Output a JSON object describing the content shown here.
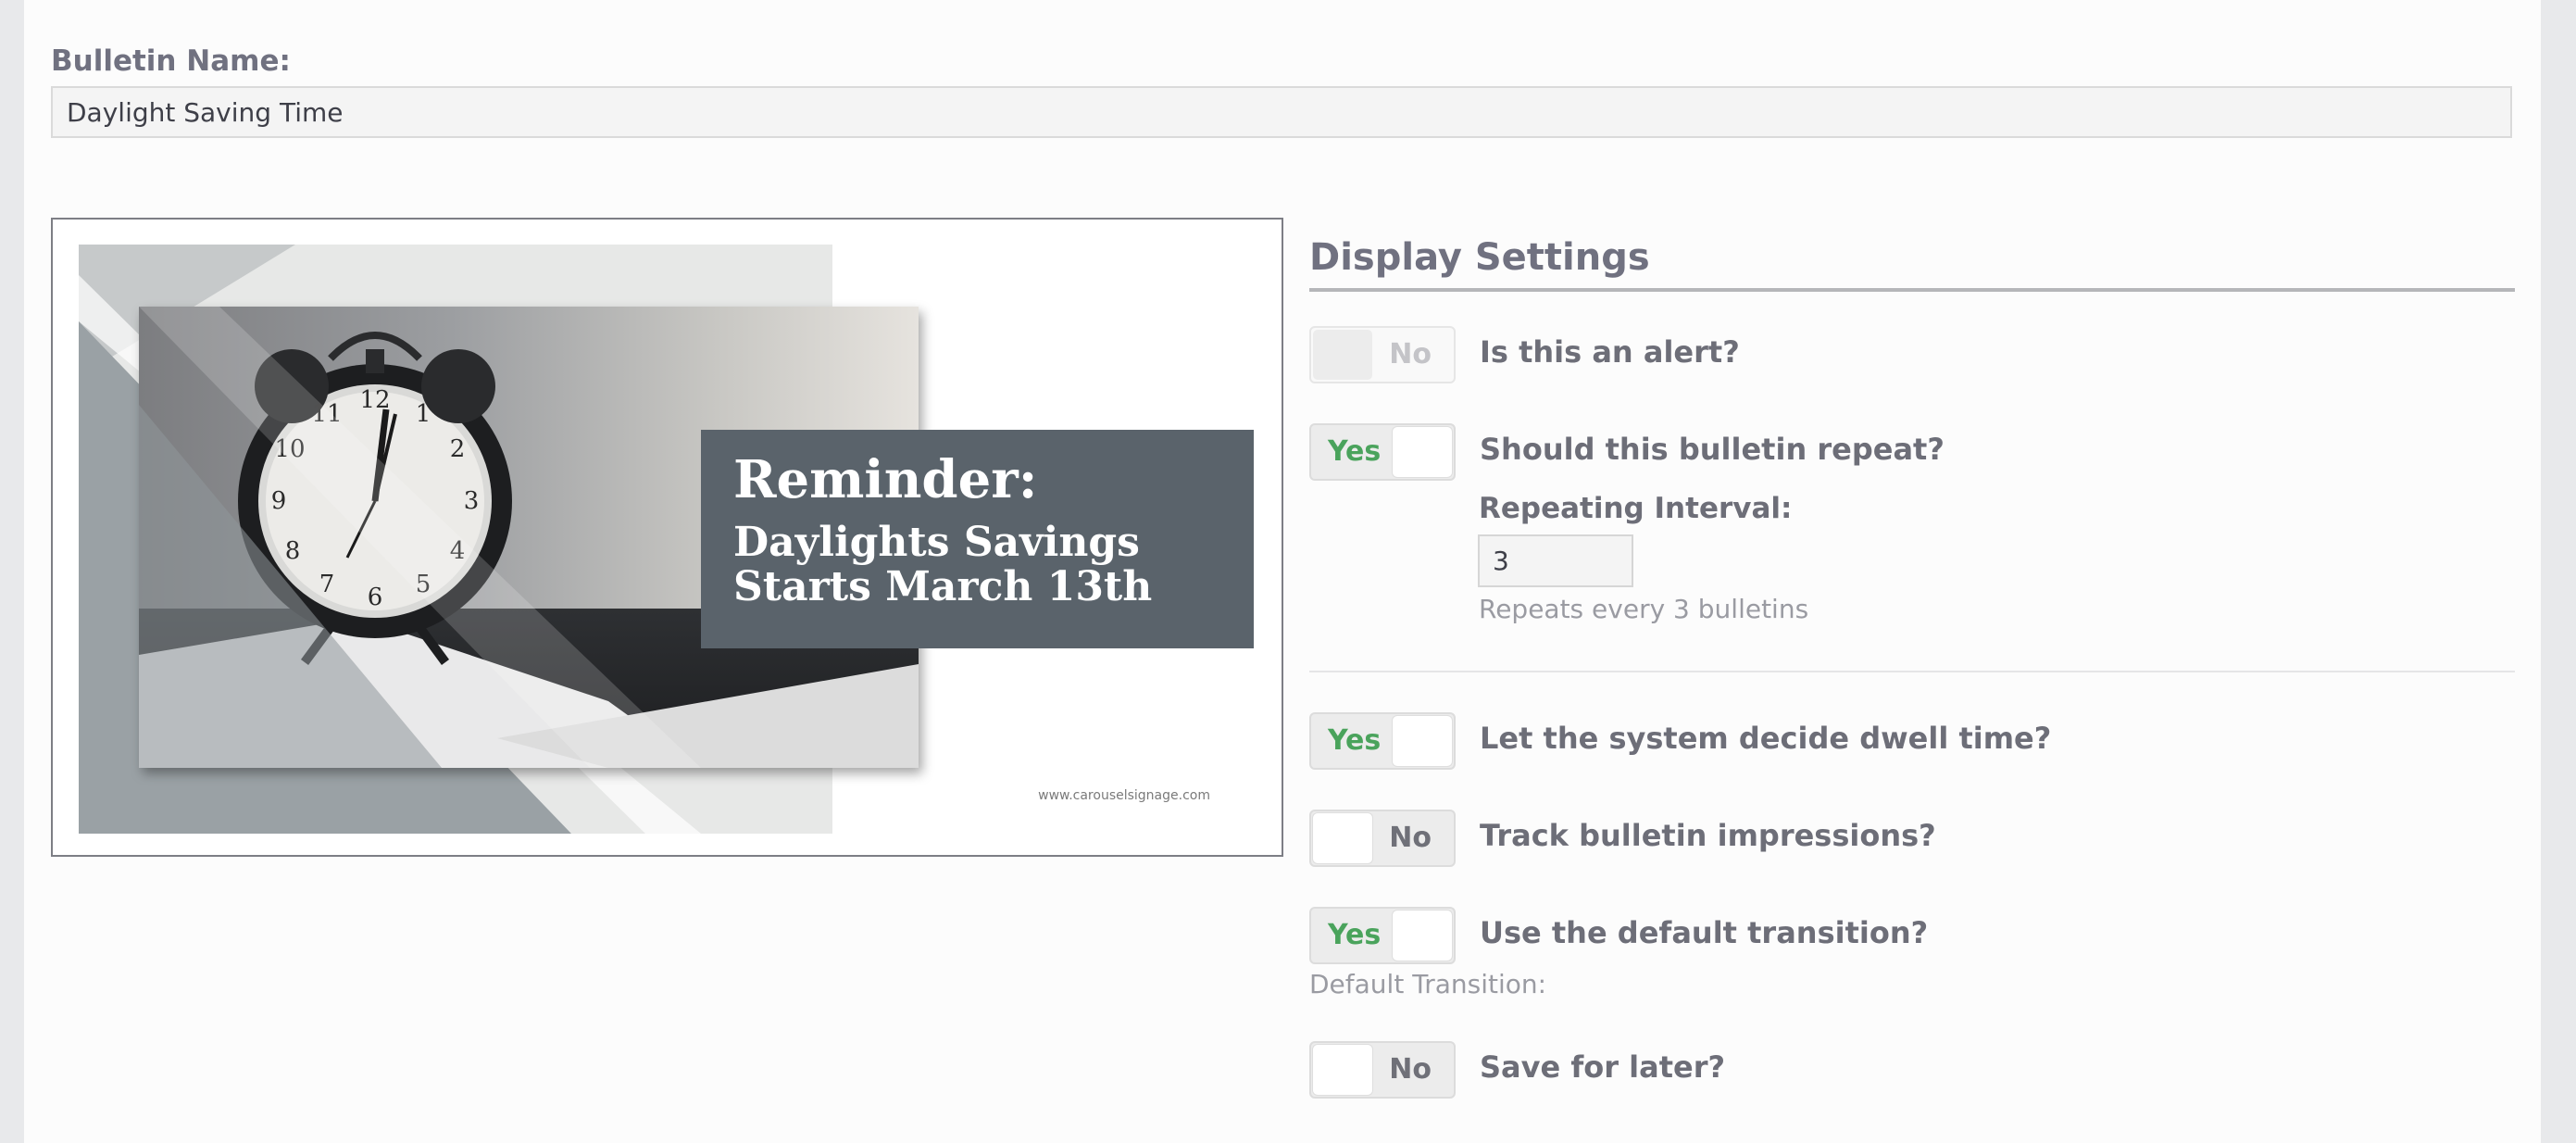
{
  "form": {
    "name_label": "Bulletin Name:",
    "name_value": "Daylight Saving Time"
  },
  "preview": {
    "heading": "Reminder:",
    "line1": "Daylights Savings",
    "line2": "Starts March 13th",
    "url": "www.carouselsignage.com"
  },
  "settings": {
    "title": "Display Settings",
    "alert": {
      "state": "No",
      "label": "Is this an alert?"
    },
    "repeat": {
      "state": "Yes",
      "label": "Should this bulletin repeat?"
    },
    "interval": {
      "label": "Repeating Interval:",
      "value": "3",
      "help": "Repeats every 3 bulletins"
    },
    "dwell": {
      "state": "Yes",
      "label": "Let the system decide dwell time?"
    },
    "impressions": {
      "state": "No",
      "label": "Track bulletin impressions?"
    },
    "transition": {
      "state": "Yes",
      "label": "Use the default transition?"
    },
    "default_transition_label": "Default Transition:",
    "save_later": {
      "state": "No",
      "label": "Save for later?"
    }
  },
  "colors": {
    "yes_green": "#4aa35c",
    "banner": "#5a636b"
  }
}
